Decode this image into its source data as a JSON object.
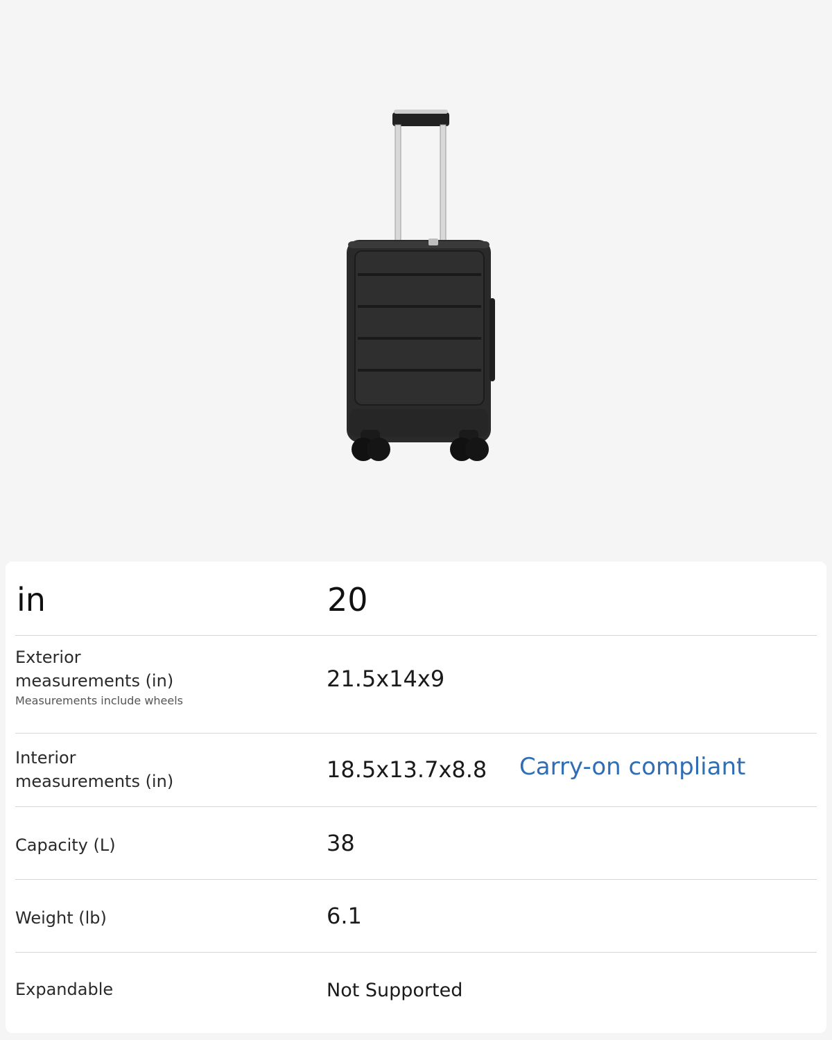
{
  "header": {
    "unit_label": "in",
    "size_value": "20"
  },
  "specs": [
    {
      "label": "Exterior",
      "label2": "measurements (in)",
      "sublabel": "Measurements include wheels",
      "value": "21.5x14x9"
    },
    {
      "label": "Interior",
      "label2": "measurements (in)",
      "value": "18.5x13.7x8.8",
      "note": "Carry-on compliant"
    },
    {
      "label": "Capacity (L)",
      "value": "38"
    },
    {
      "label": "Weight (lb)",
      "value": "6.1"
    },
    {
      "label": "Expandable",
      "value": "Not Supported"
    }
  ],
  "colors": {
    "background": "#f5f5f5",
    "card": "#ffffff",
    "accent": "#2f6db5",
    "suitcase": "#2b2b2b"
  },
  "product_image": {
    "icon": "suitcase-icon"
  }
}
